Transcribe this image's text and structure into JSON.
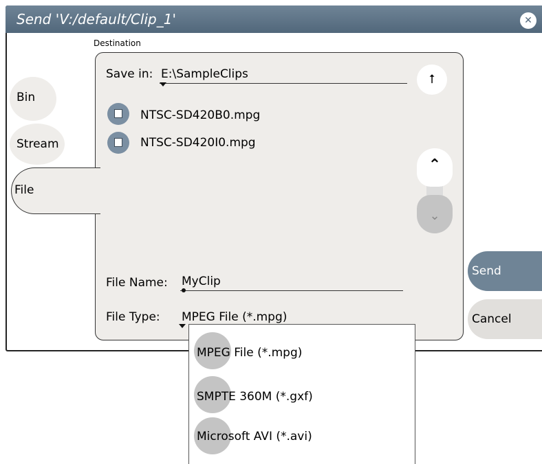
{
  "window": {
    "title": "Send 'V:/default/Clip_1'",
    "close_icon": "close-icon"
  },
  "destination_label": "Destination",
  "tabs": [
    {
      "label": "Bin",
      "selected": false
    },
    {
      "label": "Stream",
      "selected": false
    },
    {
      "label": "File",
      "selected": true
    }
  ],
  "save_in": {
    "label": "Save in:",
    "value": "E:\\SampleClips",
    "up_icon": "up-folder-icon"
  },
  "files": [
    {
      "name": "NTSC-SD420B0.mpg",
      "icon": "file-icon"
    },
    {
      "name": "NTSC-SD420I0.mpg",
      "icon": "file-icon"
    }
  ],
  "file_name": {
    "label": "File Name:",
    "value": "MyClip"
  },
  "file_type": {
    "label": "File Type:",
    "value": "MPEG File (*.mpg)",
    "options": [
      "MPEG File (*.mpg)",
      "SMPTE 360M (*.gxf)",
      "Microsoft AVI (*.avi)"
    ]
  },
  "buttons": {
    "send": "Send",
    "cancel": "Cancel"
  },
  "colors": {
    "titlebar": "#5c7185",
    "accent": "#6f8496",
    "panel": "#efedea"
  }
}
